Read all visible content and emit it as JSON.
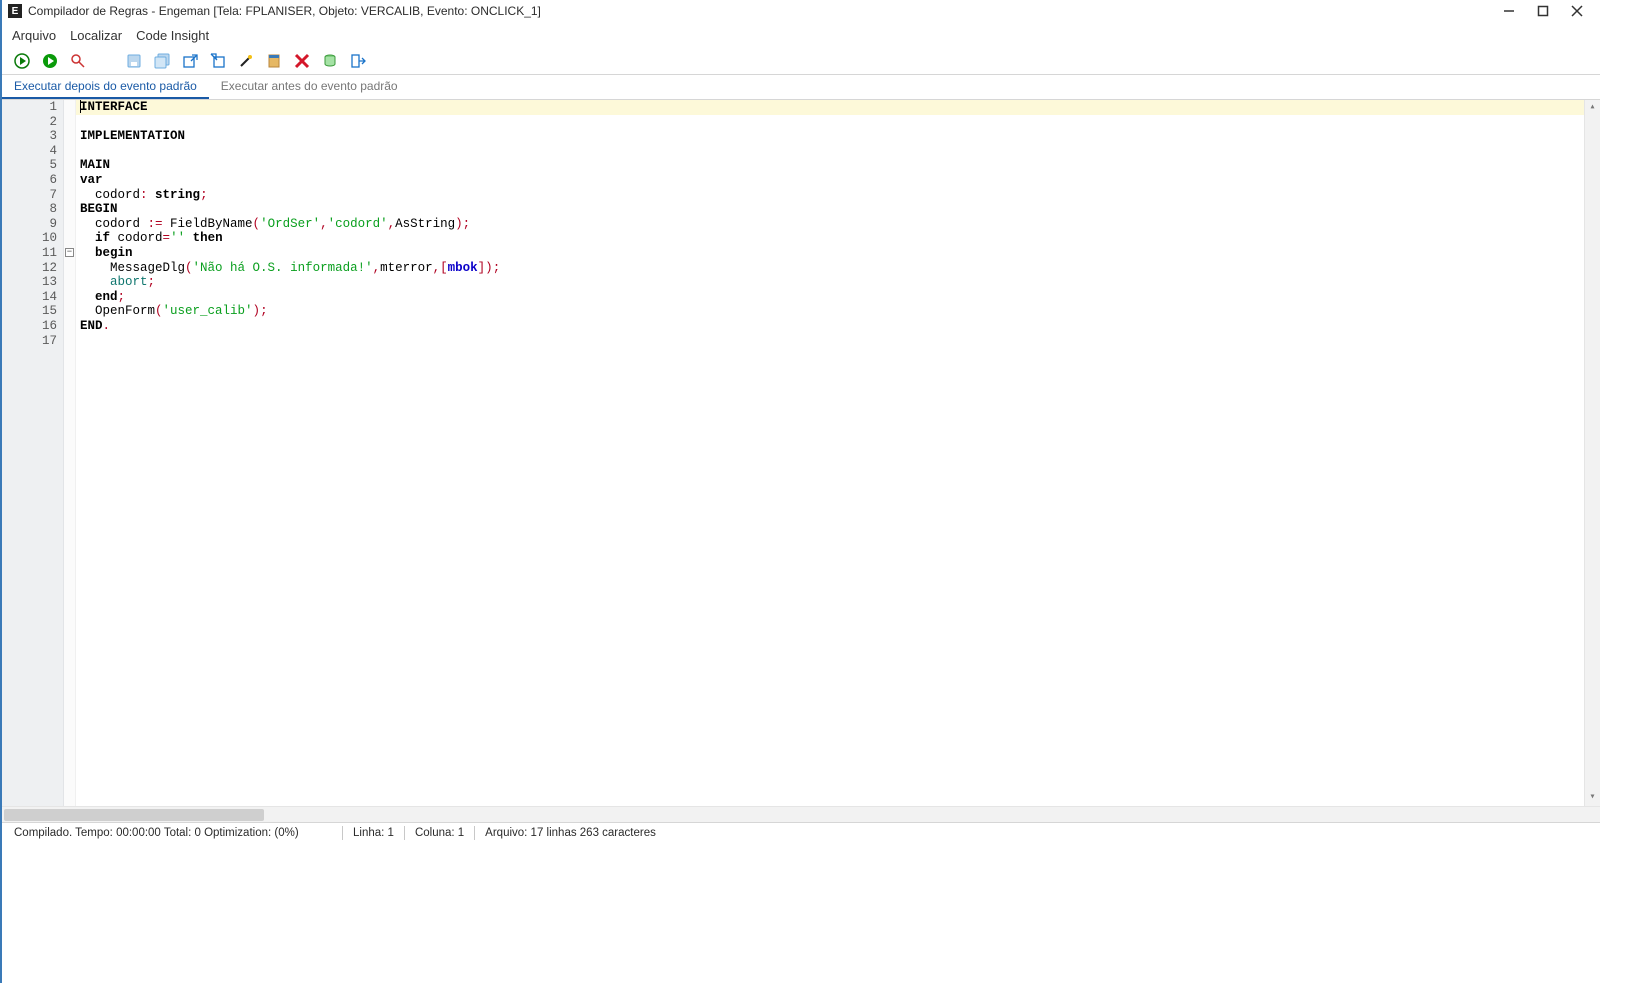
{
  "window": {
    "title": "Compilador de Regras - Engeman [Tela: FPLANISER, Objeto: VERCALIB, Evento: ONCLICK_1]",
    "logo_letter": "E"
  },
  "menubar": {
    "arquivo": "Arquivo",
    "localizar": "Localizar",
    "code_insight": "Code Insight"
  },
  "toolbar": {
    "run": "run",
    "run2": "run-alt",
    "inspect": "inspect",
    "save": "save",
    "save_all": "save-all",
    "export": "export",
    "import": "import",
    "format": "format",
    "book": "bookmark",
    "delete": "delete",
    "db": "database",
    "exit": "exit"
  },
  "tabs": {
    "after": "Executar depois do evento padrão",
    "before": "Executar antes do evento padrão"
  },
  "code": {
    "line_count": 17,
    "fold_at": 11,
    "lines": [
      {
        "n": 1,
        "tokens": [
          {
            "t": "INTERFACE",
            "c": "kw-bold"
          }
        ],
        "current": true
      },
      {
        "n": 2,
        "tokens": []
      },
      {
        "n": 3,
        "tokens": [
          {
            "t": "IMPLEMENTATION",
            "c": "kw-bold"
          }
        ]
      },
      {
        "n": 4,
        "tokens": []
      },
      {
        "n": 5,
        "tokens": [
          {
            "t": "MAIN",
            "c": "kw-bold"
          }
        ]
      },
      {
        "n": 6,
        "tokens": [
          {
            "t": "var",
            "c": "kw-bold"
          }
        ]
      },
      {
        "n": 7,
        "tokens": [
          {
            "t": "  codord",
            "c": "ident"
          },
          {
            "t": ":",
            "c": "punct"
          },
          {
            "t": " ",
            "c": "ident"
          },
          {
            "t": "string",
            "c": "kw-bold"
          },
          {
            "t": ";",
            "c": "punct"
          }
        ]
      },
      {
        "n": 8,
        "tokens": [
          {
            "t": "BEGIN",
            "c": "kw-bold"
          }
        ]
      },
      {
        "n": 9,
        "tokens": [
          {
            "t": "  codord ",
            "c": "ident"
          },
          {
            "t": ":=",
            "c": "punct"
          },
          {
            "t": " FieldByName",
            "c": "ident"
          },
          {
            "t": "(",
            "c": "punct"
          },
          {
            "t": "'OrdSer'",
            "c": "str"
          },
          {
            "t": ",",
            "c": "punct"
          },
          {
            "t": "'codord'",
            "c": "str"
          },
          {
            "t": ",",
            "c": "punct"
          },
          {
            "t": "AsString",
            "c": "ident"
          },
          {
            "t": ")",
            "c": "punct"
          },
          {
            "t": ";",
            "c": "punct"
          }
        ]
      },
      {
        "n": 10,
        "tokens": [
          {
            "t": "  ",
            "c": "ident"
          },
          {
            "t": "if",
            "c": "kw-bold"
          },
          {
            "t": " codord",
            "c": "ident"
          },
          {
            "t": "=",
            "c": "punct"
          },
          {
            "t": "''",
            "c": "str"
          },
          {
            "t": " ",
            "c": "ident"
          },
          {
            "t": "then",
            "c": "kw-bold"
          }
        ]
      },
      {
        "n": 11,
        "tokens": [
          {
            "t": "  ",
            "c": "ident"
          },
          {
            "t": "begin",
            "c": "kw-bold"
          }
        ]
      },
      {
        "n": 12,
        "tokens": [
          {
            "t": "    MessageDlg",
            "c": "ident"
          },
          {
            "t": "(",
            "c": "punct"
          },
          {
            "t": "'Não há O.S. informada!'",
            "c": "str"
          },
          {
            "t": ",",
            "c": "punct"
          },
          {
            "t": "mterror",
            "c": "ident"
          },
          {
            "t": ",",
            "c": "punct"
          },
          {
            "t": "[",
            "c": "punct"
          },
          {
            "t": "mbok",
            "c": "kw-blue"
          },
          {
            "t": "]",
            "c": "punct"
          },
          {
            "t": ")",
            "c": "punct"
          },
          {
            "t": ";",
            "c": "punct"
          }
        ]
      },
      {
        "n": 13,
        "tokens": [
          {
            "t": "    ",
            "c": "ident"
          },
          {
            "t": "abort",
            "c": "kw-teal"
          },
          {
            "t": ";",
            "c": "punct"
          }
        ]
      },
      {
        "n": 14,
        "tokens": [
          {
            "t": "  ",
            "c": "ident"
          },
          {
            "t": "end",
            "c": "kw-bold"
          },
          {
            "t": ";",
            "c": "punct"
          }
        ]
      },
      {
        "n": 15,
        "tokens": [
          {
            "t": "  OpenForm",
            "c": "ident"
          },
          {
            "t": "(",
            "c": "punct"
          },
          {
            "t": "'user_calib'",
            "c": "str"
          },
          {
            "t": ")",
            "c": "punct"
          },
          {
            "t": ";",
            "c": "punct"
          }
        ]
      },
      {
        "n": 16,
        "tokens": [
          {
            "t": "END",
            "c": "kw-bold"
          },
          {
            "t": ".",
            "c": "punct"
          }
        ]
      },
      {
        "n": 17,
        "tokens": []
      }
    ]
  },
  "statusbar": {
    "compiled": "Compilado. Tempo: 00:00:00 Total: 0 Optimization: (0%)",
    "linha": "Linha: 1",
    "coluna": "Coluna: 1",
    "arquivo": "Arquivo: 17 linhas 263 caracteres"
  }
}
